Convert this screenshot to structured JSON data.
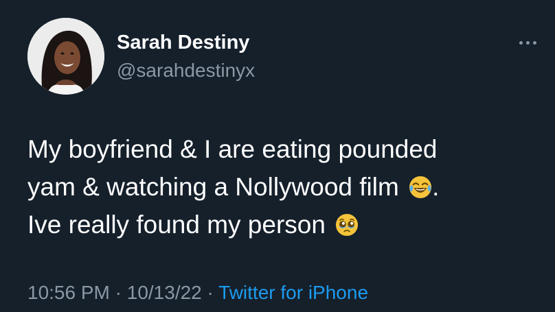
{
  "tweet": {
    "author": {
      "display_name": "Sarah Destiny",
      "handle": "@sarahdestinyx",
      "avatar": "profile-photo"
    },
    "more_icon": "more-horizontal-icon",
    "text": {
      "line1": "My boyfriend & I are eating pounded",
      "line2_text": "yam & watching a Nollywood film",
      "line2_emoji": "face-with-tears-of-joy-emoji",
      "line2_end": ".",
      "line3_text": "Ive really found my person",
      "line3_emoji": "pleading-face-emoji"
    },
    "meta": {
      "time": "10:56 PM",
      "separator1": "·",
      "date": "10/13/22",
      "separator2": "·",
      "source": "Twitter for iPhone"
    },
    "colors": {
      "background": "#15202b",
      "text": "#ffffff",
      "secondary": "#8b98a5",
      "link": "#1d9bf0"
    }
  }
}
